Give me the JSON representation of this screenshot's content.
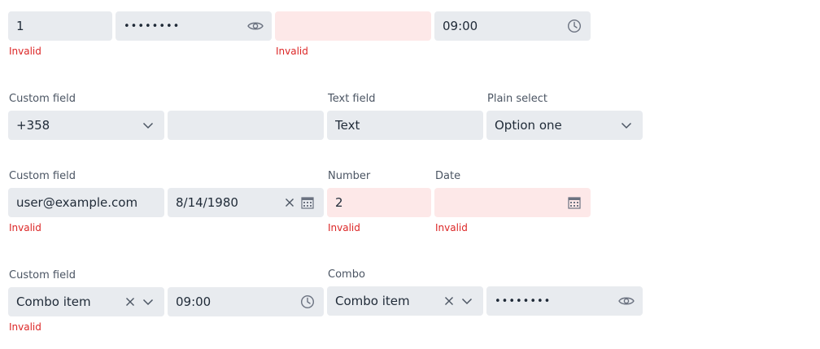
{
  "row1": {
    "field1_value": "1",
    "password1_value": "••••••••",
    "time1_value": "09:00",
    "error1": "Invalid",
    "error3": "Invalid"
  },
  "row2": {
    "custom_label": "Custom field",
    "phone_code": "+358",
    "phone_number": "",
    "text_label": "Text field",
    "text_value": "Text",
    "select_label": "Plain select",
    "select_value": "Option one"
  },
  "row3": {
    "custom_label": "Custom field",
    "email_value": "user@example.com",
    "date_value": "8/14/1980",
    "error_custom": "Invalid",
    "number_label": "Number",
    "number_value": "2",
    "error_number": "Invalid",
    "date_label": "Date",
    "date2_value": "",
    "error_date": "Invalid"
  },
  "row4": {
    "custom_label": "Custom field",
    "combo1_value": "Combo item",
    "time_value": "09:00",
    "error_custom": "Invalid",
    "combo_label": "Combo",
    "combo2_value": "Combo item",
    "password_value": "••••••••"
  },
  "icons": {
    "eye": "eye-icon",
    "clock": "clock-icon",
    "chevron": "chevron-down-icon",
    "clear": "close-icon",
    "calendar": "calendar-icon"
  },
  "colors": {
    "field_bg": "#e8ebef",
    "invalid_bg": "#fde8e8",
    "error_text": "#dc2626",
    "label_text": "#4b5563"
  }
}
